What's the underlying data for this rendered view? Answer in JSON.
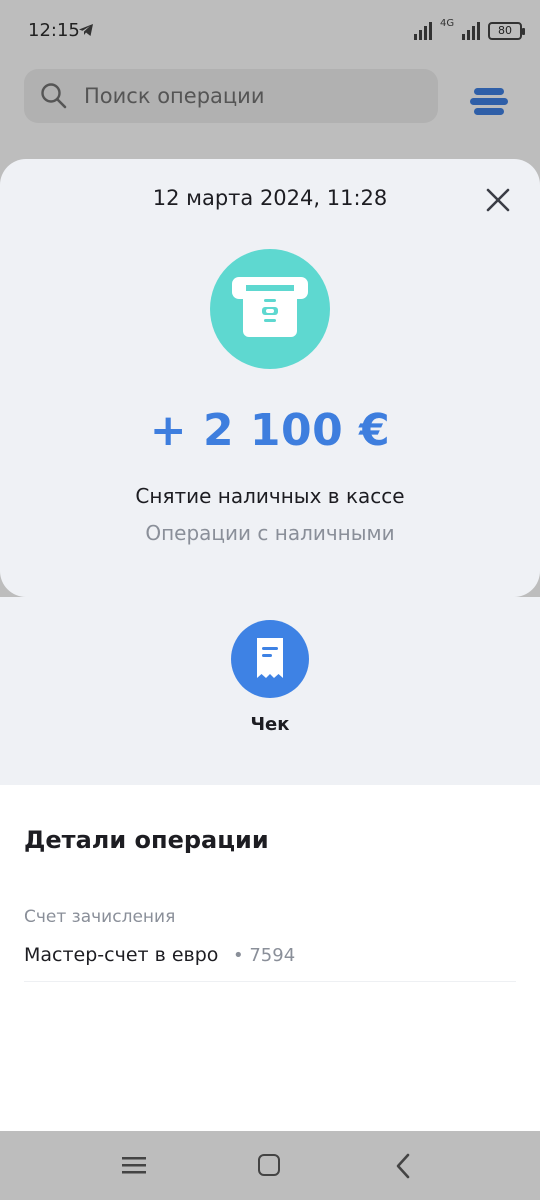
{
  "status_bar": {
    "time": "12:15",
    "network": "4G",
    "battery": "80"
  },
  "search": {
    "placeholder": "Поиск операции"
  },
  "operation": {
    "date": "12 марта 2024, 11:28",
    "amount": "+ 2 100 €",
    "title": "Снятие наличных в кассе",
    "category": "Операции с наличными",
    "icon_color": "#5ed8d0",
    "amount_color": "#3e7ede"
  },
  "actions": {
    "receipt_label": "Чек"
  },
  "details": {
    "title": "Детали операции",
    "account_label": "Счет зачисления",
    "account_value": "Мастер-счет в евро",
    "account_suffix": "• 7594"
  }
}
